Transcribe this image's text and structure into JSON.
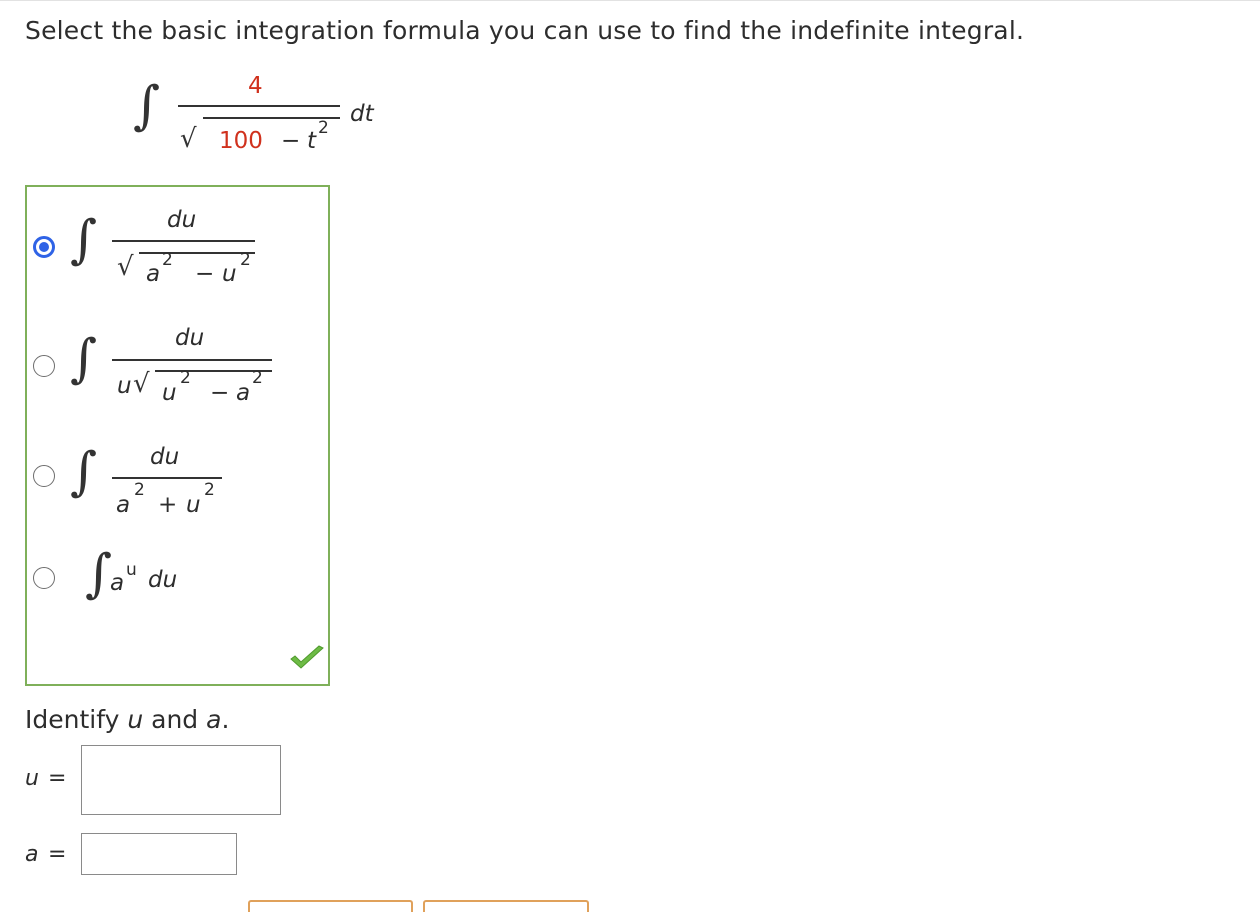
{
  "question": "Select the basic integration formula you can use to find the indefinite integral.",
  "integral": {
    "sign": "∫",
    "numerator": "4",
    "radical": "√",
    "radicand_constant": "100",
    "minus": "−",
    "variable": "t",
    "exponent": "2",
    "differential": "dt"
  },
  "choices": [
    {
      "selected": true,
      "numerator": "du",
      "denominator": {
        "a": "a",
        "a_exp": "2",
        "op": "−",
        "u": "u",
        "u_exp": "2"
      }
    },
    {
      "selected": false,
      "numerator": "du",
      "denominator": {
        "prefix": "u",
        "u": "u",
        "u_exp": "2",
        "op": "−",
        "a": "a",
        "a_exp": "2"
      }
    },
    {
      "selected": false,
      "numerator": "du",
      "denominator": {
        "a": "a",
        "a_exp": "2",
        "op": "+",
        "u": "u",
        "u_exp": "2"
      }
    },
    {
      "selected": false,
      "base": "a",
      "exponent": "u",
      "differential": "du"
    }
  ],
  "correct_indicator": "check-icon",
  "identify": {
    "prefix": "Identify ",
    "u": "u",
    "and": " and ",
    "a": "a",
    "suffix": "."
  },
  "inputs": {
    "u_label": "u",
    "a_label": "a",
    "equals": "=",
    "u_value": "",
    "a_value": ""
  },
  "colors": {
    "accent": "#2f63e6",
    "correct_border": "#7fb05a",
    "highlight": "#d0311d",
    "button_border": "#e0a15b"
  }
}
